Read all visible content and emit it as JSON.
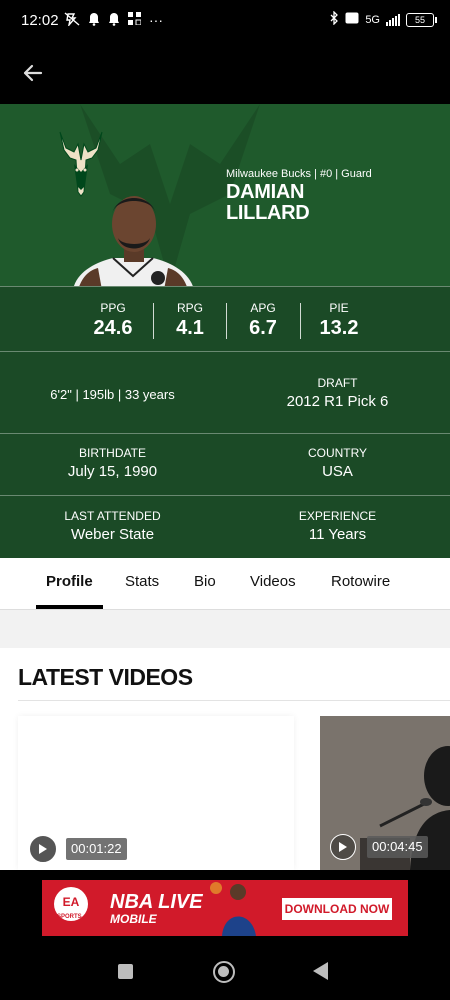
{
  "status_bar": {
    "time": "12:02",
    "more_icon": "···",
    "network": "5G",
    "battery": "55"
  },
  "app_bar": {
    "back_icon": "arrow-left-icon"
  },
  "player": {
    "team_line": "Milwaukee Bucks | #0 | Guard",
    "first_name": "DAMIAN",
    "last_name": "LILLARD"
  },
  "stats": [
    {
      "label": "PPG",
      "value": "24.6"
    },
    {
      "label": "RPG",
      "value": "4.1"
    },
    {
      "label": "APG",
      "value": "6.7"
    },
    {
      "label": "PIE",
      "value": "13.2"
    }
  ],
  "info": {
    "physical": "6'2\" | 195lb | 33 years",
    "draft_label": "DRAFT",
    "draft_value": "2012 R1 Pick 6",
    "birthdate_label": "BIRTHDATE",
    "birthdate_value": "July 15, 1990",
    "country_label": "COUNTRY",
    "country_value": "USA",
    "last_attended_label": "LAST ATTENDED",
    "last_attended_value": "Weber State",
    "experience_label": "EXPERIENCE",
    "experience_value": "11 Years"
  },
  "tabs": [
    {
      "label": "Profile",
      "active": true
    },
    {
      "label": "Stats",
      "active": false
    },
    {
      "label": "Bio",
      "active": false
    },
    {
      "label": "Videos",
      "active": false
    },
    {
      "label": "Rotowire",
      "active": false
    }
  ],
  "videos": {
    "title": "LATEST VIDEOS",
    "items": [
      {
        "duration": "00:01:22"
      },
      {
        "duration": "00:04:45"
      }
    ]
  },
  "ad": {
    "logo": "EA",
    "logo_sub": "SPORTS",
    "title": "NBA LIVE",
    "subtitle": "MOBILE",
    "cta": "DOWNLOAD NOW"
  },
  "colors": {
    "team_green": "#1f5a2c",
    "stats_green": "#1b4a26",
    "ad_red": "#d11a2a"
  }
}
